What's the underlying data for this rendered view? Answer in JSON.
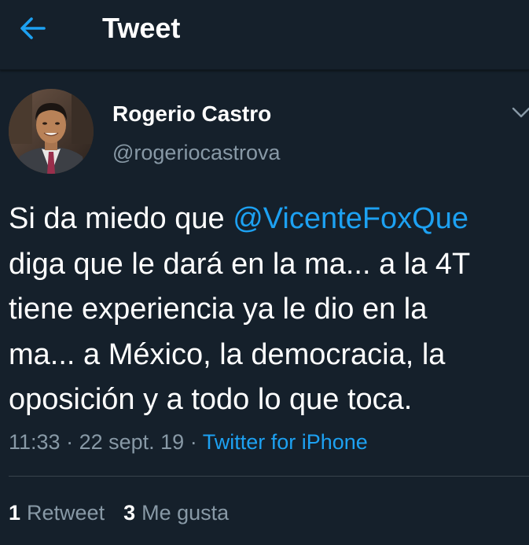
{
  "header": {
    "title": "Tweet",
    "back_icon": "arrow-left-icon"
  },
  "tweet": {
    "display_name": "Rogerio Castro",
    "handle": "@rogeriocastrova",
    "text_lines": [
      {
        "before": "Si da miedo que ",
        "mention": "@VicenteFoxQue",
        "after": ""
      },
      {
        "text": "diga que le dará en la ma... a la 4T"
      },
      {
        "text": "tiene experiencia ya le dio en la"
      },
      {
        "text": "ma... a México, la democracia, la"
      },
      {
        "text": "oposición y a todo lo que toca."
      }
    ],
    "time": "11:33",
    "separator": "·",
    "date": "22 sept. 19",
    "source": "Twitter for iPhone"
  },
  "stats": {
    "retweets": {
      "count": "1",
      "label": "Retweet"
    },
    "likes": {
      "count": "3",
      "label": "Me gusta"
    }
  },
  "colors": {
    "background": "#15202b",
    "accent": "#1da1f2",
    "secondary_text": "#8899a6",
    "divider": "#38444d"
  }
}
